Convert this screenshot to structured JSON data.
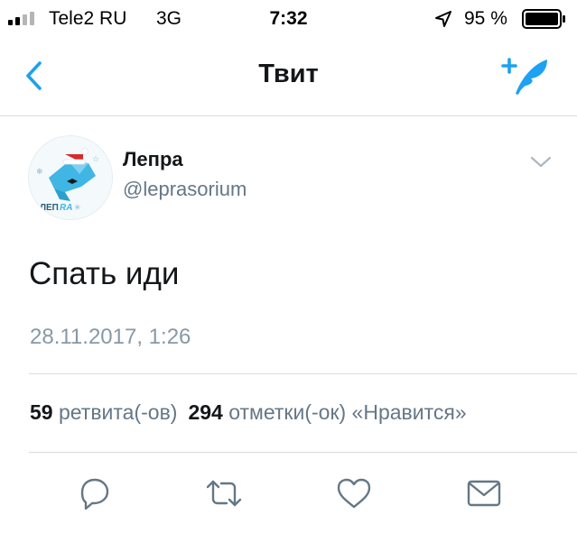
{
  "status_bar": {
    "carrier": "Tele2 RU",
    "network": "3G",
    "time": "7:32",
    "battery_percent": "95 %",
    "signal_bars_filled": 2,
    "signal_bars_total": 4,
    "location_icon": "location-arrow-icon",
    "battery_icon": "battery-icon"
  },
  "nav": {
    "title": "Твит",
    "back_icon": "chevron-left-icon",
    "compose_icon": "compose-tweet-icon"
  },
  "tweet": {
    "author_name": "Лепра",
    "author_handle": "@leprasorium",
    "avatar_logo_text": "ЛЕПRA",
    "text": "Спать иди",
    "timestamp": "28.11.2017, 1:26",
    "retweets_count": "59",
    "retweets_label": "ретвита(-ов)",
    "likes_count": "294",
    "likes_label": "отметки(-ок) «Нравится»"
  },
  "actions": {
    "reply_icon": "reply-icon",
    "retweet_icon": "retweet-icon",
    "like_icon": "heart-icon",
    "message_icon": "envelope-icon"
  },
  "colors": {
    "accent": "#1da1f2",
    "secondary_text": "#657786",
    "timestamp_text": "#8899a6",
    "action_icon": "#657786",
    "divider": "#d6dbe0"
  }
}
